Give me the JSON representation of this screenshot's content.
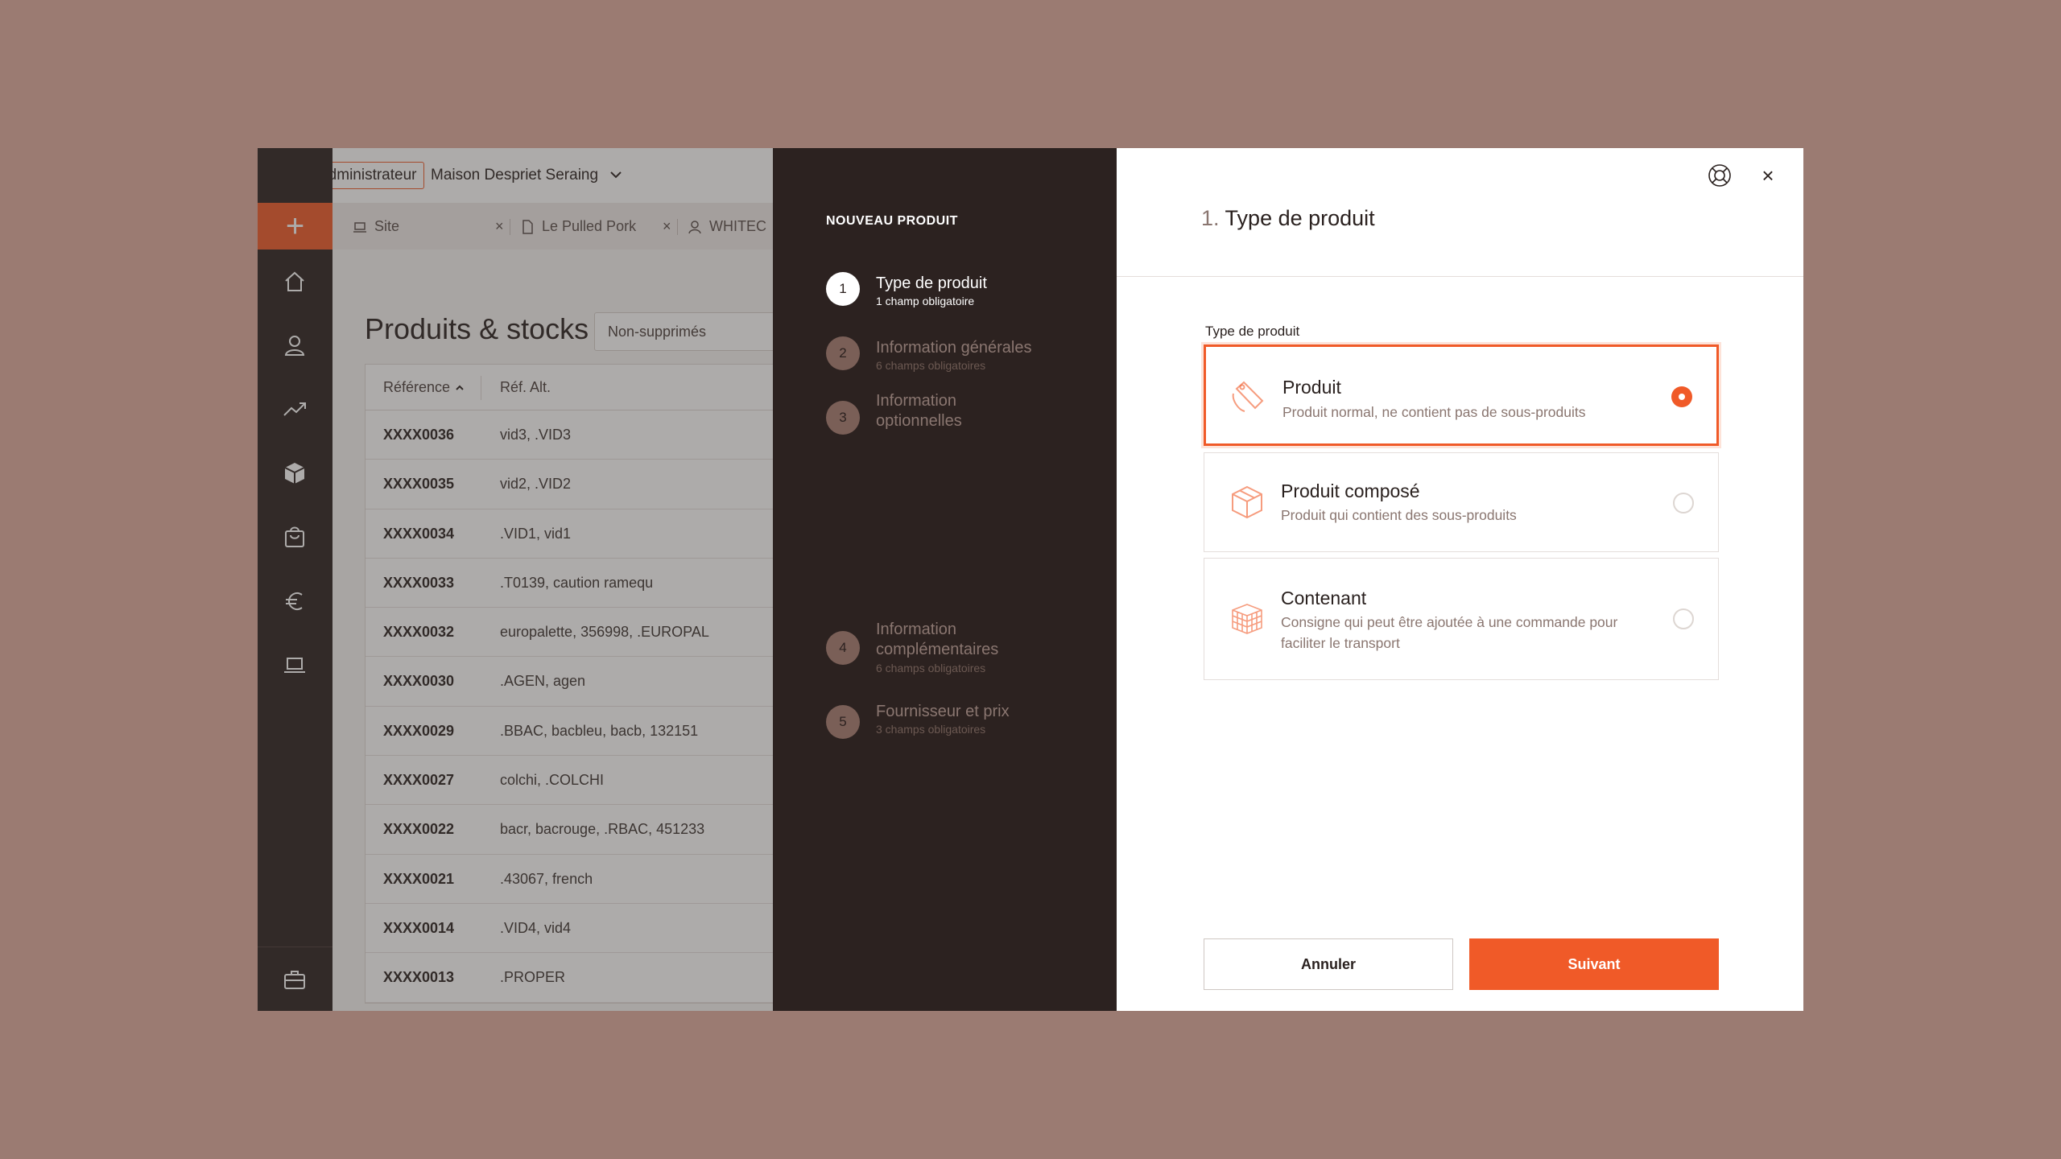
{
  "topbar": {
    "role": "Administrateur",
    "company": "Maison Despriet Seraing"
  },
  "tabs": [
    {
      "label": "Site",
      "icon": "laptop-icon"
    },
    {
      "label": "Le Pulled Pork",
      "icon": "document-icon"
    },
    {
      "label": "WHITEC",
      "icon": "user-icon"
    }
  ],
  "tab_close_glyph": "×",
  "sidebar": {
    "add_glyph": "+",
    "items": [
      "home-icon",
      "user-icon",
      "trend-icon",
      "box-icon",
      "basket-icon",
      "euro-icon",
      "laptop-icon"
    ],
    "bottom": "briefcase-icon"
  },
  "page": {
    "title": "Produits & stocks",
    "filter": "Non-supprimés",
    "columns": {
      "reference": "Référence",
      "alt": "Réf. Alt."
    },
    "rows": [
      {
        "ref": "XXXX0036",
        "alt": "vid3, .VID3"
      },
      {
        "ref": "XXXX0035",
        "alt": "vid2, .VID2"
      },
      {
        "ref": "XXXX0034",
        "alt": ".VID1, vid1"
      },
      {
        "ref": "XXXX0033",
        "alt": ".T0139, caution ramequ"
      },
      {
        "ref": "XXXX0032",
        "alt": "europalette, 356998, .EUROPAL"
      },
      {
        "ref": "XXXX0030",
        "alt": ".AGEN, agen"
      },
      {
        "ref": "XXXX0029",
        "alt": ".BBAC, bacbleu, bacb, 132151"
      },
      {
        "ref": "XXXX0027",
        "alt": "colchi, .COLCHI"
      },
      {
        "ref": "XXXX0022",
        "alt": "bacr, bacrouge, .RBAC, 451233"
      },
      {
        "ref": "XXXX0021",
        "alt": ".43067, french"
      },
      {
        "ref": "XXXX0014",
        "alt": ".VID4, vid4"
      },
      {
        "ref": "XXXX0013",
        "alt": ".PROPER"
      }
    ]
  },
  "stepper": {
    "title": "NOUVEAU PRODUIT",
    "steps": [
      {
        "num": "1",
        "label": "Type de produit",
        "sub": "1 champ obligatoire",
        "active": true
      },
      {
        "num": "2",
        "label": "Information générales",
        "sub": "6 champs obligatoires"
      },
      {
        "num": "3",
        "label": "Information optionnelles",
        "sub": ""
      },
      {
        "num": "4",
        "label": "Information complémentaires",
        "sub": "6 champs obligatoires"
      },
      {
        "num": "5",
        "label": "Fournisseur et prix",
        "sub": "3 champs obligatoires"
      }
    ]
  },
  "modal": {
    "step_number": "1.",
    "step_title": "Type de produit",
    "close_glyph": "×",
    "field_label": "Type de produit",
    "options": [
      {
        "title": "Produit",
        "desc": "Produit normal, ne contient pas de sous-produits",
        "icon": "tag-icon",
        "selected": true
      },
      {
        "title": "Produit composé",
        "desc": "Produit qui contient des sous-produits",
        "icon": "box-icon",
        "selected": false
      },
      {
        "title": "Contenant",
        "desc": "Consigne qui peut être ajoutée à une commande pour faciliter le transport",
        "icon": "crate-icon",
        "selected": false
      }
    ],
    "cancel": "Annuler",
    "next": "Suivant"
  },
  "colors": {
    "accent": "#f05a28",
    "dark": "#2c2220",
    "backdrop": "#9b7b72"
  }
}
